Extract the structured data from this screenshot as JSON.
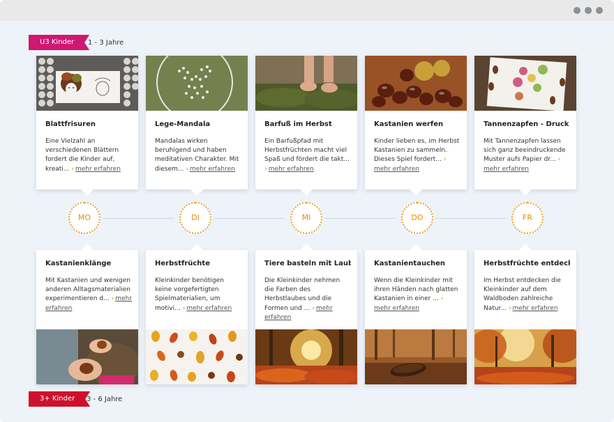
{
  "groups": {
    "top": {
      "badge": "U3 Kinder",
      "range": "1 - 3 Jahre",
      "color": "#d01774"
    },
    "bottom": {
      "badge": "3+ Kinder",
      "range": "3 - 6 Jahre",
      "color": "#d0102b"
    }
  },
  "days": [
    "MO",
    "DI",
    "MI",
    "DO",
    "FR"
  ],
  "more_label": "mehr erfahren",
  "top_cards": [
    {
      "title": "Blattfrisuren",
      "text": "Eine Vielzahl an verschiedenen Blättern fordert die Kinder auf, kreati...",
      "image": "leaf-hairstyle-photo"
    },
    {
      "title": "Lege-Mandala",
      "text": "Mandalas wirken beruhigend und haben meditativen Charakter. Mit diesem...",
      "image": "mandala-photo"
    },
    {
      "title": "Barfuß im Herbst",
      "text": "Ein Barfußpfad mit Herbstfrüchten macht viel Spaß und fördert die takt...",
      "image": "barefoot-photo"
    },
    {
      "title": "Kastanien werfen",
      "text": "Kinder lieben es, im Herbst Kastanien zu sammeln. Dieses Spiel fordert...",
      "image": "chestnuts-photo"
    },
    {
      "title": "Tannenzapfen - Druck",
      "text": "Mit Tannenzapfen lassen sich ganz beeindruckende Muster aufs Papier dr...",
      "image": "pinecone-print-photo"
    }
  ],
  "bottom_cards": [
    {
      "title": "Kastanienklänge",
      "text": "Mit Kastanien und wenigen anderen Alltagsmaterialien experimentieren d...",
      "image": "chestnut-hands-photo"
    },
    {
      "title": "Herbstfrüchte",
      "text": "Kleinkinder benötigen keine vorgefertigten Spielmaterialien, um motivi...",
      "image": "autumn-leaves-flatlay-photo"
    },
    {
      "title": "Tiere basteln mit Laub",
      "text": "Die Kleinkinder nehmen die Farben des Herbstlaubes und die Formen und ...",
      "image": "autumn-forest-photo"
    },
    {
      "title": "Kastanientauchen",
      "text": "Wenn die Kleinkinder mit ihren Händen nach glatten Kastanien in einer ...",
      "image": "pinecone-forest-photo"
    },
    {
      "title": "Herbstfrüchte entdeck...",
      "text": "Im Herbst entdecken die Kleinkinder auf dem Waldboden zahlreiche Natur...",
      "image": "autumn-path-photo"
    }
  ],
  "colors": {
    "accent": "#f08a00",
    "background": "#eef3f9"
  }
}
